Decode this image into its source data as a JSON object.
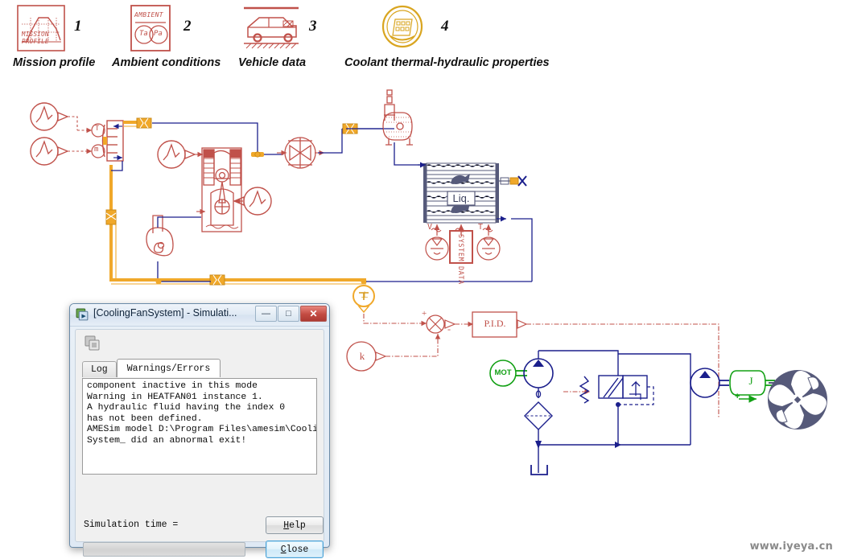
{
  "legend": {
    "items": [
      {
        "num": "1",
        "label": "Mission profile",
        "icon": "mission-profile-icon",
        "icon_text_1": "MISSION",
        "icon_text_2": "PROFILE"
      },
      {
        "num": "2",
        "label": "Ambient conditions",
        "icon": "ambient-conditions-icon",
        "icon_text_1": "AMBIENT",
        "icon_text_2": "Ta",
        "icon_text_3": "Pa"
      },
      {
        "num": "3",
        "label": "Vehicle data",
        "icon": "vehicle-data-icon"
      },
      {
        "num": "4",
        "label": "Coolant thermal-hydraulic properties",
        "icon": "coolant-properties-icon"
      }
    ]
  },
  "schematic": {
    "labels": {
      "temperature_port": "T",
      "massflow_port": "m",
      "radiator_liquid": "Liq.",
      "system_data": "SYSTEM DATA",
      "system_data_line1": "SYSTEM",
      "system_data_line2": "DATA",
      "air_velocity_sensor": "V",
      "air_temperature_sensor": "T",
      "pid_controller": "P.I.D.",
      "gain_block": "k",
      "sum_plus": "+",
      "sum_minus": "-",
      "ground_node": "⊥",
      "electric_motor": "MOT",
      "inertia": "J",
      "inertia_sign_plus": "+"
    },
    "colors": {
      "thermal_red": "#c0514a",
      "pipe_orange": "#f0a82a",
      "hydraulic_blue": "#1b1f8c",
      "signal_green": "#12a014",
      "fan_gray": "#565a7a",
      "sheet_background": "#ffffff"
    }
  },
  "dialog": {
    "title": "[CoolingFanSystem] - Simulati...",
    "icon": "amesim-app-icon",
    "window_buttons": [
      {
        "name": "minimize-button",
        "glyph": "—"
      },
      {
        "name": "maximize-button",
        "glyph": "□"
      },
      {
        "name": "close-window-button",
        "glyph": "✕"
      }
    ],
    "toolbar_icon": "run-simulation-icon",
    "tabs": [
      {
        "label": "Log",
        "active": false
      },
      {
        "label": "Warnings/Errors",
        "active": true
      }
    ],
    "log_text": "component inactive in this mode\nWarning in HEATFAN01 instance 1.\nA hydraulic fluid having the index 0\nhas not been defined.\nAMESim model D:\\Program Files\\amesim\\CoolingFan\nSystem_ did an abnormal exit!",
    "simulation_time_label": "Simulation time =",
    "progress_value": "",
    "help_button": {
      "prefix": "",
      "accel": "H",
      "suffix": "elp"
    },
    "close_button": {
      "prefix": "",
      "accel": "C",
      "suffix": "lose"
    }
  },
  "watermark": {
    "text": "www.iyeya.cn"
  }
}
